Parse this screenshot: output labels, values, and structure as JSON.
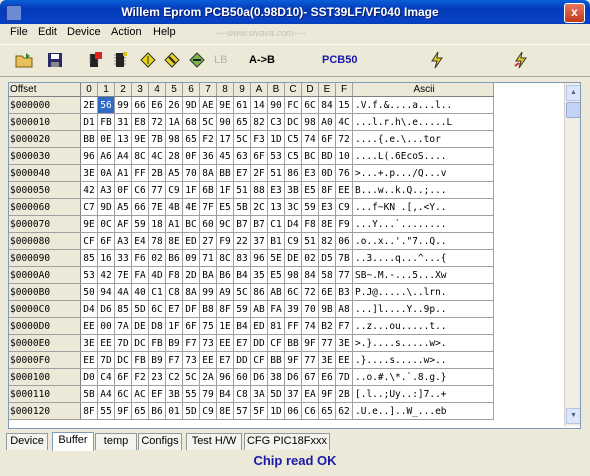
{
  "window": {
    "title": "Willem Eprom PCB50a(0.98D10)- SST39LF/VF040 Image",
    "close_label": "x"
  },
  "menu": [
    "File",
    "Edit",
    "Device",
    "Action",
    "Help"
  ],
  "watermark": "----www.sivava.com----",
  "toolbar": {
    "lb_label": "LB",
    "ab_label": "A->B",
    "pcb_label": "PCB50"
  },
  "grid": {
    "headers": {
      "offset": "Offset",
      "ascii": "Ascii",
      "cols": [
        "0",
        "1",
        "2",
        "3",
        "4",
        "5",
        "6",
        "7",
        "8",
        "9",
        "A",
        "B",
        "C",
        "D",
        "E",
        "F"
      ]
    },
    "selected": {
      "row": 0,
      "col": 1
    },
    "rows": [
      {
        "offset": "$000000",
        "bytes": [
          "2E",
          "56",
          "99",
          "66",
          "E6",
          "26",
          "9D",
          "AE",
          "9E",
          "61",
          "14",
          "90",
          "FC",
          "6C",
          "84",
          "15"
        ],
        "ascii": ".V.f.&....a...l.."
      },
      {
        "offset": "$000010",
        "bytes": [
          "D1",
          "FB",
          "31",
          "E8",
          "72",
          "1A",
          "68",
          "5C",
          "90",
          "65",
          "82",
          "C3",
          "DC",
          "98",
          "A0",
          "4C"
        ],
        "ascii": "...l.r.h\\.e.....L"
      },
      {
        "offset": "$000020",
        "bytes": [
          "BB",
          "0E",
          "13",
          "9E",
          "7B",
          "98",
          "65",
          "F2",
          "17",
          "5C",
          "F3",
          "1D",
          "C5",
          "74",
          "6F",
          "72"
        ],
        "ascii": "....{.e.\\...tor"
      },
      {
        "offset": "$000030",
        "bytes": [
          "96",
          "A6",
          "A4",
          "8C",
          "4C",
          "28",
          "0F",
          "36",
          "45",
          "63",
          "6F",
          "53",
          "C5",
          "BC",
          "BD",
          "10"
        ],
        "ascii": "....L(.6EcoS...."
      },
      {
        "offset": "$000040",
        "bytes": [
          "3E",
          "0A",
          "A1",
          "FF",
          "2B",
          "A5",
          "70",
          "8A",
          "BB",
          "E7",
          "2F",
          "51",
          "86",
          "E3",
          "0D",
          "76"
        ],
        "ascii": ">...+.p.../Q...v"
      },
      {
        "offset": "$000050",
        "bytes": [
          "42",
          "A3",
          "0F",
          "C6",
          "77",
          "C9",
          "1F",
          "6B",
          "1F",
          "51",
          "88",
          "E3",
          "3B",
          "E5",
          "8F",
          "EE"
        ],
        "ascii": "B...w..k.Q..;..."
      },
      {
        "offset": "$000060",
        "bytes": [
          "C7",
          "9D",
          "A5",
          "66",
          "7E",
          "4B",
          "4E",
          "7F",
          "E5",
          "5B",
          "2C",
          "13",
          "3C",
          "59",
          "E3",
          "C9"
        ],
        "ascii": "...f~KN .[,.<Y.."
      },
      {
        "offset": "$000070",
        "bytes": [
          "9E",
          "0C",
          "AF",
          "59",
          "18",
          "A1",
          "BC",
          "60",
          "9C",
          "B7",
          "B7",
          "C1",
          "D4",
          "F8",
          "8E",
          "F9"
        ],
        "ascii": "...Y...`........"
      },
      {
        "offset": "$000080",
        "bytes": [
          "CF",
          "6F",
          "A3",
          "E4",
          "78",
          "8E",
          "ED",
          "27",
          "F9",
          "22",
          "37",
          "B1",
          "C9",
          "51",
          "82",
          "06"
        ],
        "ascii": ".o..x..'.\"7..Q.."
      },
      {
        "offset": "$000090",
        "bytes": [
          "85",
          "16",
          "33",
          "F6",
          "02",
          "B6",
          "09",
          "71",
          "8C",
          "83",
          "96",
          "5E",
          "DE",
          "02",
          "D5",
          "7B"
        ],
        "ascii": "..3....q...^...{"
      },
      {
        "offset": "$0000A0",
        "bytes": [
          "53",
          "42",
          "7E",
          "FA",
          "4D",
          "F8",
          "2D",
          "BA",
          "B6",
          "B4",
          "35",
          "E5",
          "98",
          "84",
          "58",
          "77"
        ],
        "ascii": "SB~.M.-...5...Xw"
      },
      {
        "offset": "$0000B0",
        "bytes": [
          "50",
          "94",
          "4A",
          "40",
          "C1",
          "C8",
          "8A",
          "99",
          "A9",
          "5C",
          "86",
          "AB",
          "6C",
          "72",
          "6E",
          "B3"
        ],
        "ascii": "P.J@.....\\..lrn."
      },
      {
        "offset": "$0000C0",
        "bytes": [
          "D4",
          "D6",
          "85",
          "5D",
          "6C",
          "E7",
          "DF",
          "B8",
          "8F",
          "59",
          "AB",
          "FA",
          "39",
          "70",
          "9B",
          "A8"
        ],
        "ascii": "...]l....Y..9p.."
      },
      {
        "offset": "$0000D0",
        "bytes": [
          "EE",
          "00",
          "7A",
          "DE",
          "D8",
          "1F",
          "6F",
          "75",
          "1E",
          "B4",
          "ED",
          "81",
          "FF",
          "74",
          "B2",
          "F7"
        ],
        "ascii": "..z...ou.....t.."
      },
      {
        "offset": "$0000E0",
        "bytes": [
          "3E",
          "EE",
          "7D",
          "DC",
          "FB",
          "B9",
          "F7",
          "73",
          "EE",
          "E7",
          "DD",
          "CF",
          "BB",
          "9F",
          "77",
          "3E"
        ],
        "ascii": ">.}....s.....w>."
      },
      {
        "offset": "$0000F0",
        "bytes": [
          "EE",
          "7D",
          "DC",
          "FB",
          "B9",
          "F7",
          "73",
          "EE",
          "E7",
          "DD",
          "CF",
          "BB",
          "9F",
          "77",
          "3E",
          "EE"
        ],
        "ascii": ".}....s.....w>.."
      },
      {
        "offset": "$000100",
        "bytes": [
          "D0",
          "C4",
          "6F",
          "F2",
          "23",
          "C2",
          "5C",
          "2A",
          "96",
          "60",
          "D6",
          "38",
          "D6",
          "67",
          "E6",
          "7D"
        ],
        "ascii": "..o.#.\\*.`.8.g.}"
      },
      {
        "offset": "$000110",
        "bytes": [
          "5B",
          "A4",
          "6C",
          "AC",
          "EF",
          "3B",
          "55",
          "79",
          "B4",
          "C8",
          "3A",
          "5D",
          "37",
          "EA",
          "9F",
          "2B"
        ],
        "ascii": "[.l..;Uy..:]7..+"
      },
      {
        "offset": "$000120",
        "bytes": [
          "8F",
          "55",
          "9F",
          "65",
          "B6",
          "01",
          "5D",
          "C9",
          "8E",
          "57",
          "5F",
          "1D",
          "06",
          "C6",
          "65",
          "62"
        ],
        "ascii": ".U.e..]..W_...eb"
      }
    ]
  },
  "tabs": [
    "Device",
    "Buffer",
    "temp",
    "Configs",
    "Test H/W",
    "CFG PIC18Fxxx"
  ],
  "active_tab": "Buffer",
  "status": {
    "text": "Chip read OK"
  },
  "colors": {
    "selection": "#316ac5",
    "status_text": "#1a1aa8",
    "titlebar": "#0842c7"
  },
  "icons": [
    "open-folder-icon",
    "save-disk-icon",
    "read-chip-icon",
    "program-chip-icon",
    "verify-icon",
    "blank-check-icon",
    "erase-icon",
    "lightning-icon",
    "lightning-icon-2"
  ]
}
